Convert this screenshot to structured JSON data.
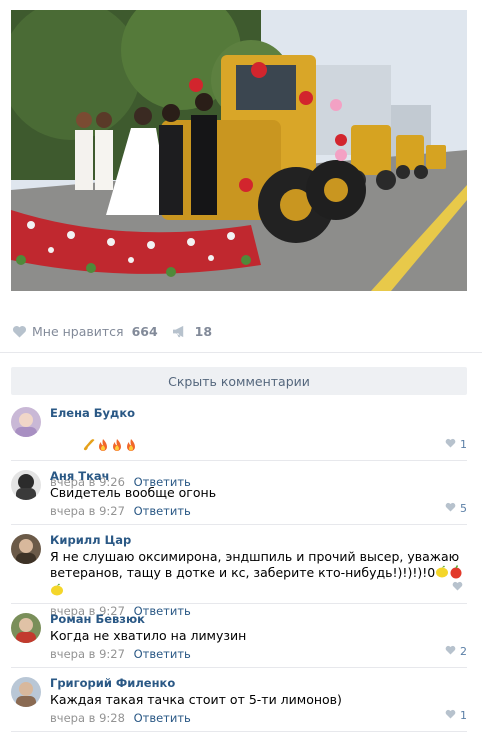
{
  "post": {
    "likes_label": "Мне нравится",
    "likes_count": "664",
    "shares_count": "18"
  },
  "hide_comments_label": "Скрыть комментарии",
  "comments": [
    {
      "author": "Елена Будко",
      "text": "",
      "time": "вчера в 9:26",
      "reply": "Ответить",
      "likes": "1",
      "avatar_color": "#c9b8d6"
    },
    {
      "author": "Аня Ткач",
      "text": "Свидетель вообще огонь",
      "time": "вчера в 9:27",
      "reply": "Ответить",
      "likes": "5",
      "avatar_color": "#2b2b2b"
    },
    {
      "author": "Кирилл Цар",
      "text": "Я не слушаю оксимирона, эндшпиль и прочий высер, уважаю ветеранов, тащу в дотке и кс, заберите кто-нибудь!)!)!)!0",
      "time": "вчера в 9:27",
      "reply": "Ответить",
      "likes": "",
      "avatar_color": "#6b5a48"
    },
    {
      "author": "Роман Бевзюк",
      "text": "Когда не хватило на лимузин",
      "time": "вчера в 9:27",
      "reply": "Ответить",
      "likes": "2",
      "avatar_color": "#7a8f5a"
    },
    {
      "author": "Григорий Филенко",
      "text": "Каждая такая тачка стоит от 5-ти лимонов)",
      "time": "вчера в 9:28",
      "reply": "Ответить",
      "likes": "1",
      "avatar_color": "#d8b89c"
    }
  ],
  "colors": {
    "link": "#2a5885",
    "meta": "#939393",
    "like_icon": "#5b7fa6"
  }
}
